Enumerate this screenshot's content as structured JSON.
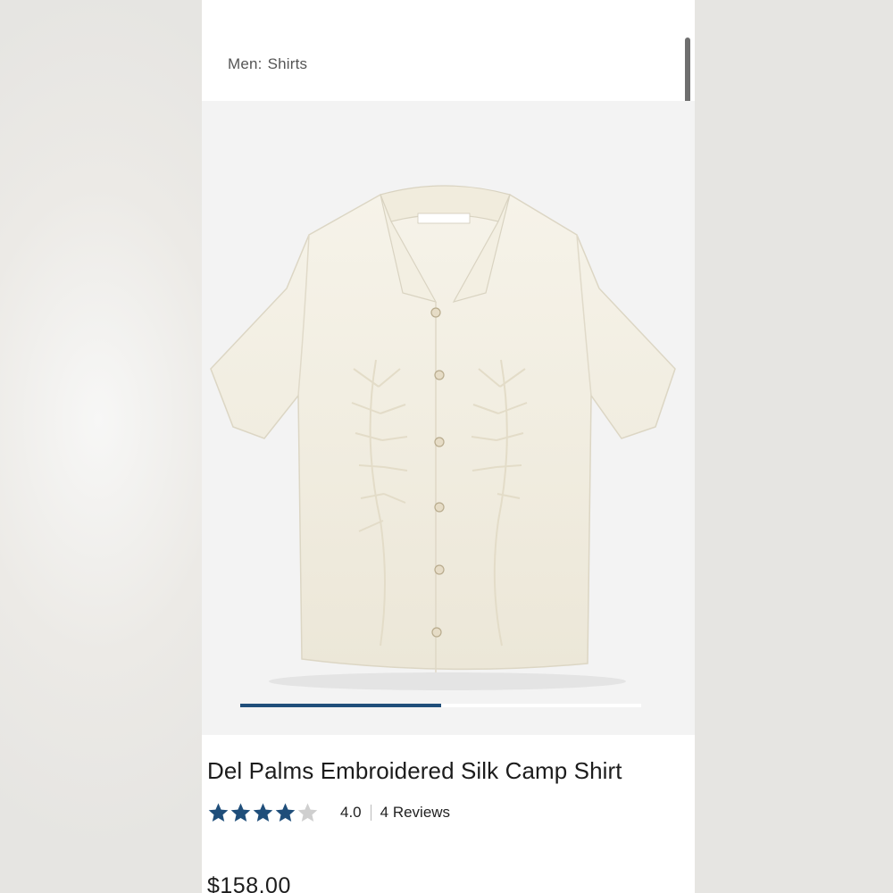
{
  "breadcrumb": {
    "category": "Men:",
    "subcategory": "Shirts"
  },
  "product": {
    "name": "Del Palms Embroidered Silk Camp Shirt",
    "rating": 4.0,
    "rating_text": "4.0",
    "reviews_label": "4 Reviews",
    "price": "$158.00",
    "image_icon": "shirt-photo"
  },
  "gallery": {
    "progress_fraction": 0.5
  },
  "colors": {
    "accent": "#1f4e7a",
    "star_filled": "#1f4e7a",
    "star_empty": "#cfcfcf"
  }
}
